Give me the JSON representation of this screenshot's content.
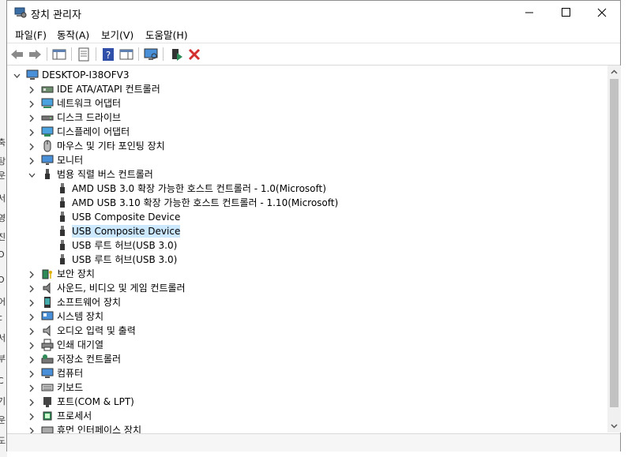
{
  "window": {
    "title": "장치 관리자",
    "controls": {
      "minimize": "minimize-icon",
      "maximize": "maximize-icon",
      "close": "close-icon"
    }
  },
  "menu": [
    "파일(F)",
    "동작(A)",
    "보기(V)",
    "도움말(H)"
  ],
  "toolbar": {
    "buttons": [
      "back-icon",
      "forward-icon",
      "show-hide-console-tree-icon",
      "properties-icon",
      "help-icon",
      "show-action-pane-icon",
      "scan-hardware-icon",
      "update-driver-icon",
      "uninstall-device-icon"
    ]
  },
  "background_text": [
    "축",
    "탕",
    "운",
    "서",
    "영",
    "진",
    "O",
    "O",
    "어",
    "c",
    "서",
    "부",
    "C",
    "기",
    "운",
    "도"
  ],
  "tree": {
    "root": "DESKTOP-I38OFV3",
    "categories": [
      {
        "label": "IDE ATA/ATAPI 컨트롤러",
        "icon": "ide-controller-icon",
        "expanded": false
      },
      {
        "label": "네트워크 어댑터",
        "icon": "network-adapter-icon",
        "expanded": false
      },
      {
        "label": "디스크 드라이브",
        "icon": "disk-drive-icon",
        "expanded": false
      },
      {
        "label": "디스플레이 어댑터",
        "icon": "display-adapter-icon",
        "expanded": false
      },
      {
        "label": "마우스 및 기타 포인팅 장치",
        "icon": "mouse-icon",
        "expanded": false
      },
      {
        "label": "모니터",
        "icon": "monitor-icon",
        "expanded": false
      },
      {
        "label": "범용 직렬 버스 컨트롤러",
        "icon": "usb-icon",
        "expanded": true,
        "children": [
          "AMD USB 3.0 확장 가능한 호스트 컨트롤러 - 1.0(Microsoft)",
          "AMD USB 3.10 확장 가능한 호스트 컨트롤러 - 1.10(Microsoft)",
          "USB Composite Device",
          "USB Composite Device",
          "USB 루트 허브(USB 3.0)",
          "USB 루트 허브(USB 3.0)"
        ],
        "selected_child": 3
      },
      {
        "label": "보안 장치",
        "icon": "security-device-icon",
        "expanded": false
      },
      {
        "label": "사운드, 비디오 및 게임 컨트롤러",
        "icon": "sound-icon",
        "expanded": false
      },
      {
        "label": "소프트웨어 장치",
        "icon": "software-device-icon",
        "expanded": false
      },
      {
        "label": "시스템 장치",
        "icon": "system-device-icon",
        "expanded": false
      },
      {
        "label": "오디오 입력 및 출력",
        "icon": "audio-icon",
        "expanded": false
      },
      {
        "label": "인쇄 대기열",
        "icon": "printer-icon",
        "expanded": false
      },
      {
        "label": "저장소 컨트롤러",
        "icon": "storage-controller-icon",
        "expanded": false
      },
      {
        "label": "컴퓨터",
        "icon": "computer-icon",
        "expanded": false
      },
      {
        "label": "키보드",
        "icon": "keyboard-icon",
        "expanded": false
      },
      {
        "label": "포트(COM & LPT)",
        "icon": "port-icon",
        "expanded": false
      },
      {
        "label": "프로세서",
        "icon": "processor-icon",
        "expanded": false
      },
      {
        "label": "휴먼 인터페이스 장치",
        "icon": "hid-icon",
        "expanded": false
      }
    ]
  },
  "colors": {
    "selection": "#cce8ff",
    "accent": "#0078d7",
    "close_red": "#d32f2f",
    "green": "#2e8b57"
  }
}
